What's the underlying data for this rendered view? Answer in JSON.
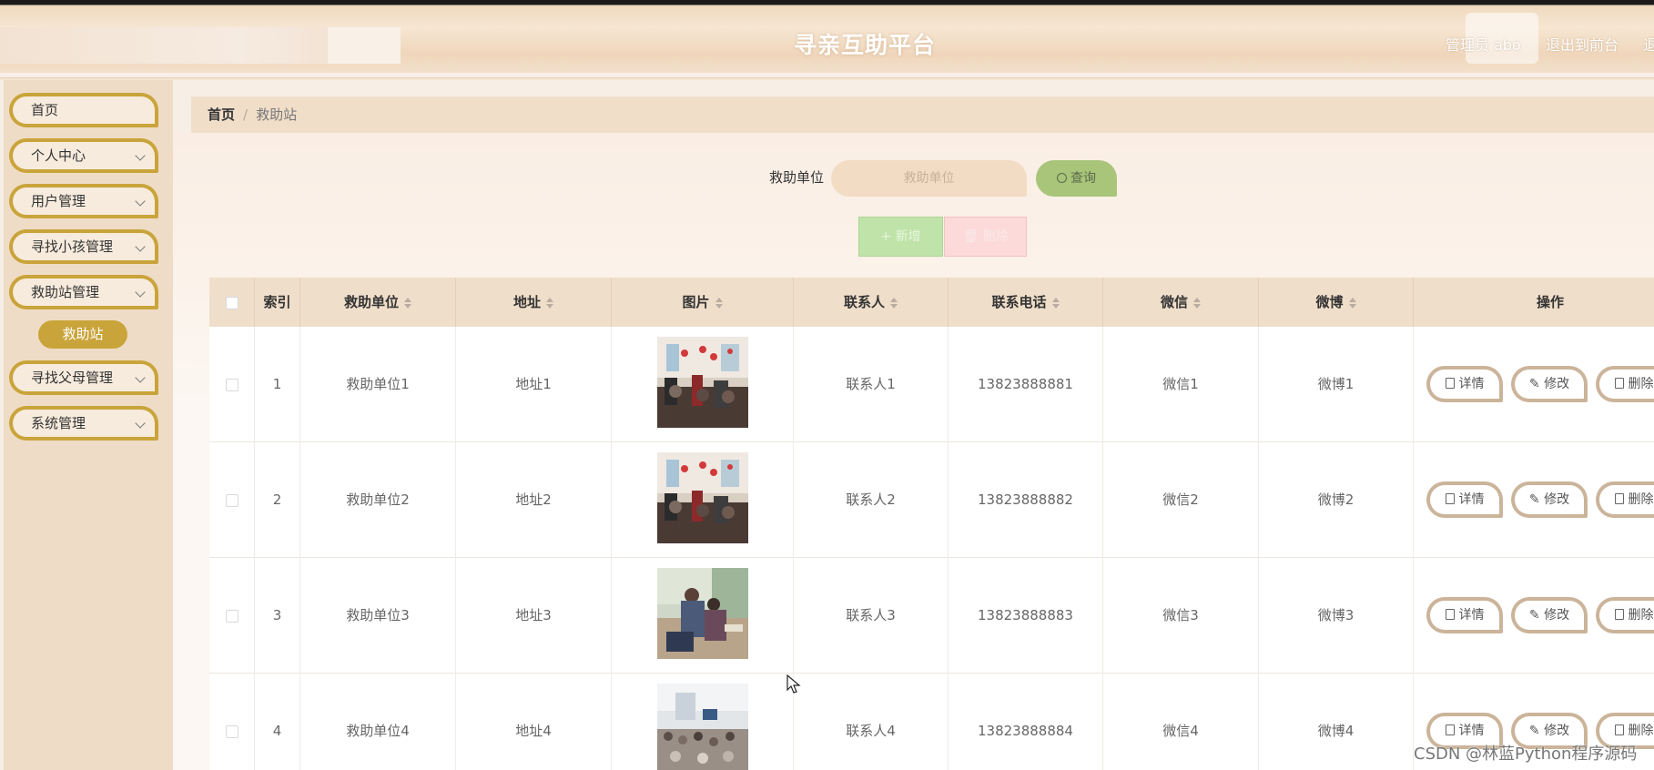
{
  "header": {
    "title": "寻亲互助平台",
    "admin_label": "管理员 abo",
    "back_to_front": "退出到前台",
    "logout_partial": "退"
  },
  "sidebar": {
    "items": [
      {
        "label": "首页",
        "has_chevron": false
      },
      {
        "label": "个人中心",
        "has_chevron": true
      },
      {
        "label": "用户管理",
        "has_chevron": true
      },
      {
        "label": "寻找小孩管理",
        "has_chevron": true
      },
      {
        "label": "救助站管理",
        "has_chevron": true
      },
      {
        "label": "寻找父母管理",
        "has_chevron": true
      },
      {
        "label": "系统管理",
        "has_chevron": true
      }
    ],
    "active_sub": "救助站"
  },
  "breadcrumb": {
    "home": "首页",
    "separator": "/",
    "current": "救助站"
  },
  "search": {
    "label": "救助单位",
    "placeholder": "救助单位",
    "query_label": "查询"
  },
  "actions": {
    "add_label": "新增",
    "delete_label": "删除"
  },
  "table": {
    "columns": [
      "索引",
      "救助单位",
      "地址",
      "图片",
      "联系人",
      "联系电话",
      "微信",
      "微博",
      "操作"
    ],
    "rows": [
      {
        "index": "1",
        "unit": "救助单位1",
        "address": "地址1",
        "contact": "联系人1",
        "phone": "13823888881",
        "wechat": "微信1",
        "weibo": "微博1"
      },
      {
        "index": "2",
        "unit": "救助单位2",
        "address": "地址2",
        "contact": "联系人2",
        "phone": "13823888882",
        "wechat": "微信2",
        "weibo": "微博2"
      },
      {
        "index": "3",
        "unit": "救助单位3",
        "address": "地址3",
        "contact": "联系人3",
        "phone": "13823888883",
        "wechat": "微信3",
        "weibo": "微博3"
      },
      {
        "index": "4",
        "unit": "救助单位4",
        "address": "地址4",
        "contact": "联系人4",
        "phone": "13823888884",
        "wechat": "微信4",
        "weibo": "微博4"
      }
    ],
    "row_actions": {
      "detail": "详情",
      "edit": "修改",
      "delete": "删除"
    }
  },
  "watermark": "CSDN @林蓝Python程序源码",
  "colors": {
    "accent": "#c9a43a",
    "header_bg": "#efdec9",
    "query_green": "#a9c57a",
    "add_green": "#bfe3a9",
    "delete_pink": "#fbdad9"
  }
}
